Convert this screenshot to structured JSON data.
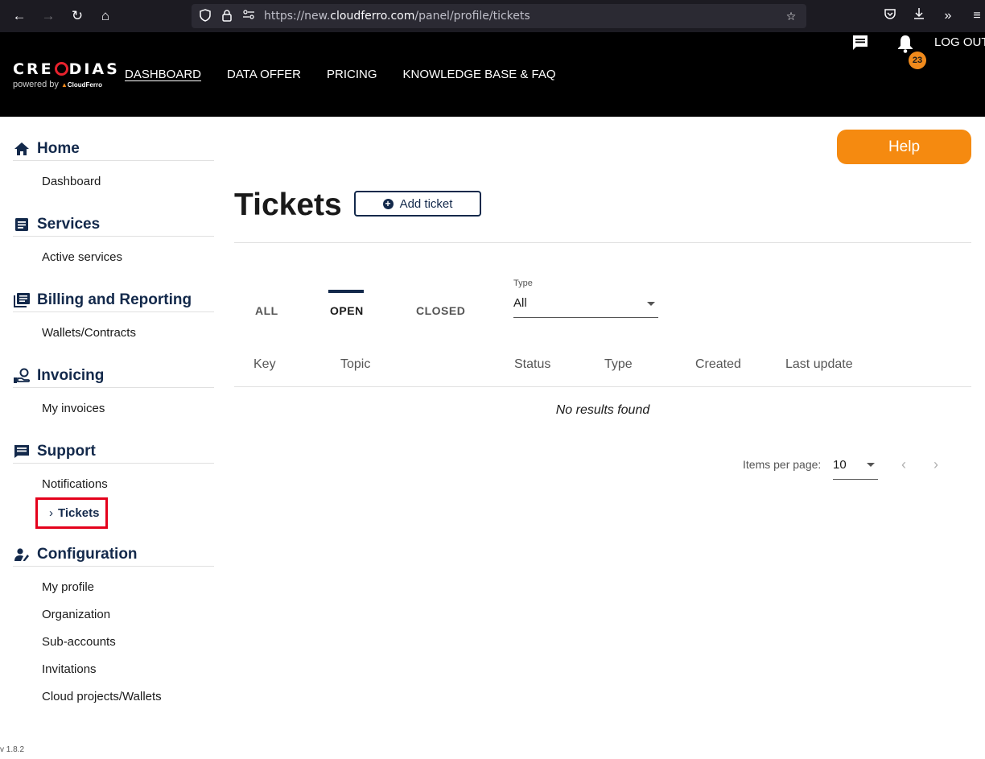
{
  "browser": {
    "url_prefix": "https://new.",
    "url_domain": "cloudferro.com",
    "url_path": "/panel/profile/tickets"
  },
  "header": {
    "logo_text_1": "CRE",
    "logo_text_2": "DIAS",
    "logo_sub": "powered by",
    "logo_brand": "CloudFerro",
    "nav": [
      "DASHBOARD",
      "DATA OFFER",
      "PRICING",
      "KNOWLEDGE BASE & FAQ"
    ],
    "notification_count": "23",
    "logout_label": "LOG OUT"
  },
  "sidebar": {
    "sections": [
      {
        "title": "Home",
        "icon": "home-icon",
        "items": [
          "Dashboard"
        ]
      },
      {
        "title": "Services",
        "icon": "services-icon",
        "items": [
          "Active services"
        ]
      },
      {
        "title": "Billing and Reporting",
        "icon": "billing-icon",
        "items": [
          "Wallets/Contracts"
        ]
      },
      {
        "title": "Invoicing",
        "icon": "invoicing-icon",
        "items": [
          "My invoices"
        ]
      },
      {
        "title": "Support",
        "icon": "support-icon",
        "items": [
          "Notifications",
          "Tickets"
        ]
      },
      {
        "title": "Configuration",
        "icon": "configuration-icon",
        "items": [
          "My profile",
          "Organization",
          "Sub-accounts",
          "Invitations",
          "Cloud projects/Wallets"
        ]
      }
    ],
    "current_item": "Tickets"
  },
  "main": {
    "help_label": "Help",
    "title": "Tickets",
    "add_ticket_label": "Add ticket",
    "tabs": [
      "ALL",
      "OPEN",
      "CLOSED"
    ],
    "active_tab": "OPEN",
    "type_filter": {
      "label": "Type",
      "value": "All"
    },
    "columns": [
      "Key",
      "Topic",
      "Status",
      "Type",
      "Created",
      "Last update"
    ],
    "empty_message": "No results found",
    "pagination": {
      "items_per_page_label": "Items per page:",
      "items_per_page": "10"
    }
  },
  "footer": {
    "version": "v 1.8.2"
  },
  "colors": {
    "brand_navy": "#13294b",
    "accent_orange": "#f58a10",
    "highlight_red": "#e4001b"
  }
}
